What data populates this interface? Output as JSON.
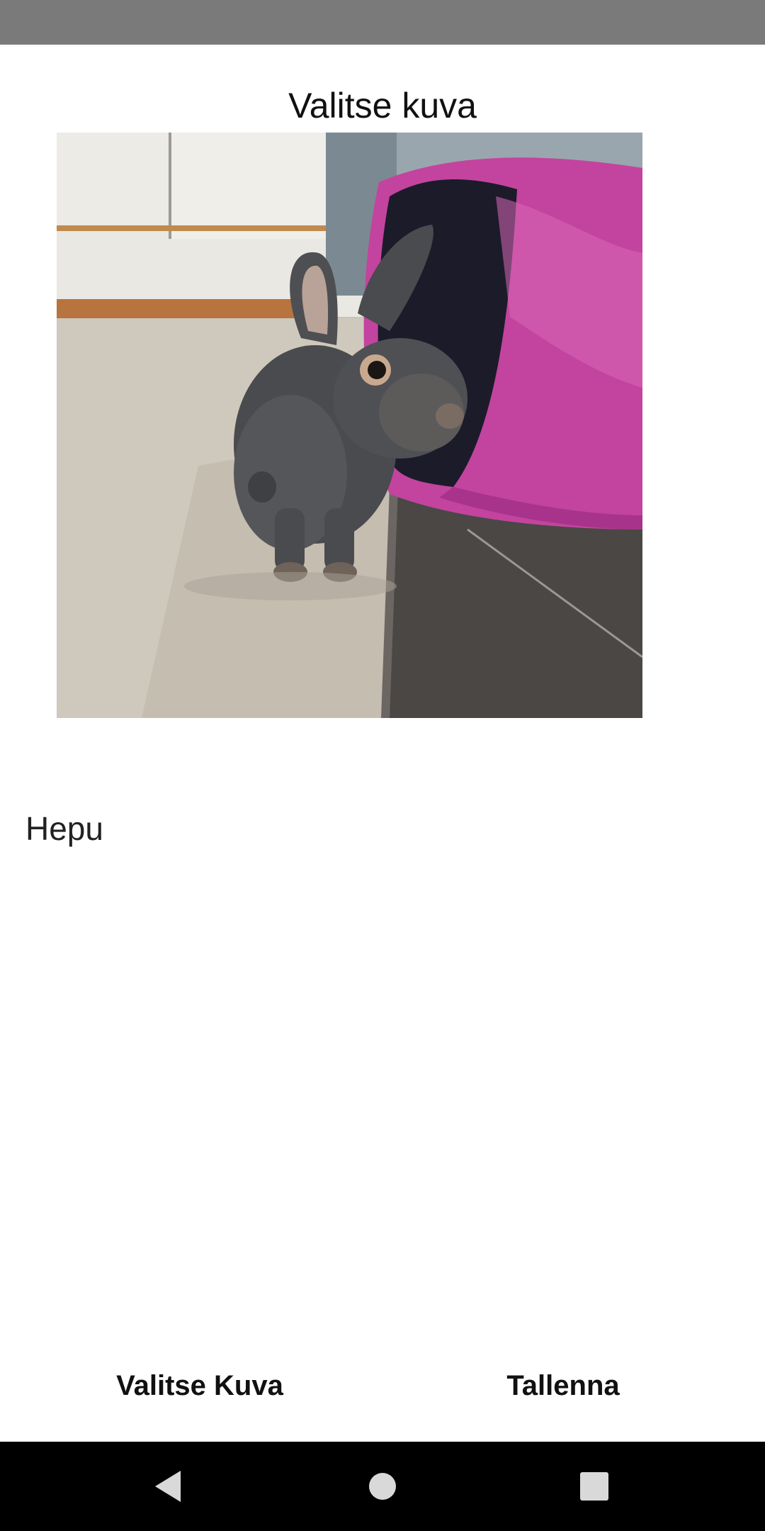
{
  "screen": {
    "title": "Valitse kuva"
  },
  "photo": {
    "subject": "rabbit-photo"
  },
  "name_field": {
    "value": "Hepu"
  },
  "buttons": {
    "choose_label": "Valitse Kuva",
    "save_label": "Tallenna"
  },
  "navigation": {
    "back_icon": "back-icon",
    "home_icon": "home-icon",
    "recent_icon": "recent-apps-icon"
  },
  "colors": {
    "status_bar": "#7a7a7a",
    "nav_bar": "#000000",
    "background": "#ffffff",
    "tunnel": "#c2449f"
  }
}
